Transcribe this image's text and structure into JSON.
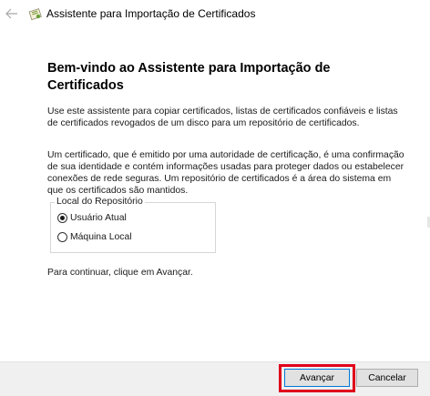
{
  "window": {
    "title": "Assistente para Importação de Certificados"
  },
  "icons": {
    "back": "back-arrow-icon",
    "app": "certificate-icon"
  },
  "main": {
    "heading": "Bem-vindo ao Assistente para Importação de Certificados",
    "paragraph1": "Use este assistente para copiar certificados, listas de certificados confiáveis e listas de certificados revogados de um disco para um repositório de certificados.",
    "paragraph2": "Um certificado, que é emitido por uma autoridade de certificação, é uma confirmação de sua identidade e contém informações usadas para proteger dados ou estabelecer conexões de rede seguras. Um repositório de certificados é a área do sistema em que os certificados são mantidos.",
    "store_location": {
      "legend": "Local do Repositório",
      "options": [
        {
          "label": "Usuário Atual",
          "selected": true
        },
        {
          "label": "Máquina Local",
          "selected": false
        }
      ]
    },
    "continue_text": "Para continuar, clique em Avançar."
  },
  "footer": {
    "next_label": "Avançar",
    "cancel_label": "Cancelar"
  },
  "colors": {
    "highlight": "#e0001b",
    "accent": "#0078d7",
    "footer_bg": "#f0f0f0"
  }
}
